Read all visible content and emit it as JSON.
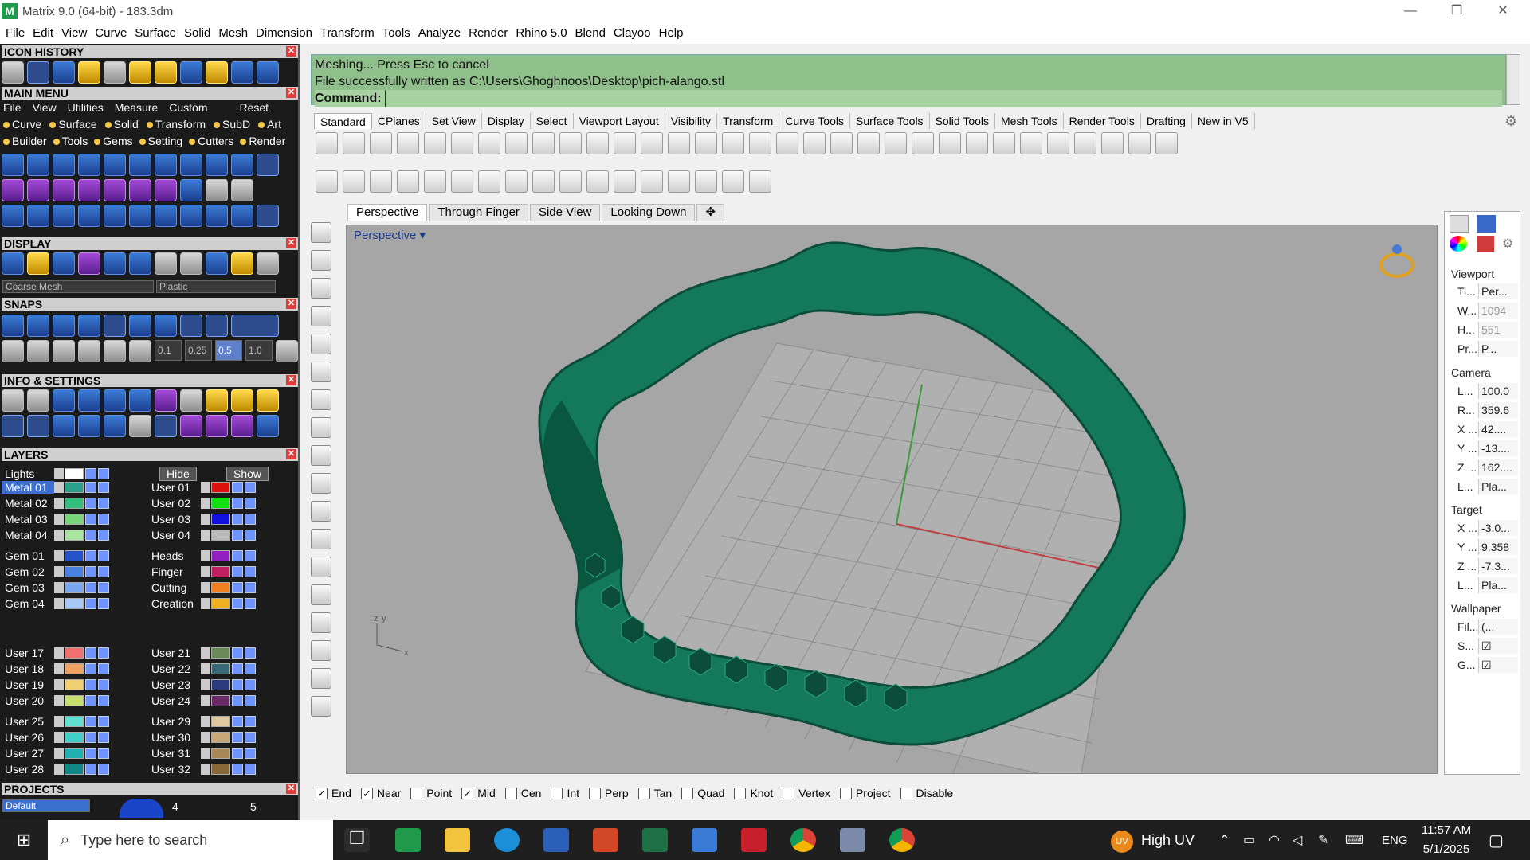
{
  "window": {
    "title": "Matrix 9.0 (64-bit) - 183.3dm",
    "minimize": "—",
    "restore": "❐",
    "close": "✕"
  },
  "menu": [
    "File",
    "Edit",
    "View",
    "Curve",
    "Surface",
    "Solid",
    "Mesh",
    "Dimension",
    "Transform",
    "Tools",
    "Analyze",
    "Render",
    "Rhino 5.0",
    "Blend",
    "Clayoo",
    "Help"
  ],
  "panels": {
    "icon_history": "ICON HISTORY",
    "main_menu": "MAIN MENU",
    "display": "DISPLAY",
    "snaps": "SNAPS",
    "info_settings": "INFO & SETTINGS",
    "layers": "LAYERS",
    "projects": "PROJECTS"
  },
  "main_menu_row1": [
    "File",
    "View",
    "Utilities",
    "Measure",
    "Custom",
    "Reset"
  ],
  "main_menu_row2": [
    "Curve",
    "Surface",
    "Solid",
    "Transform",
    "SubD",
    "Art"
  ],
  "main_menu_row3": [
    "Builder",
    "Tools",
    "Gems",
    "Setting",
    "Cutters",
    "Render"
  ],
  "display_selects": {
    "mesh": "Coarse Mesh",
    "material": "Plastic"
  },
  "snaps_values": [
    "0.1",
    "0.25",
    "0.5",
    "1.0"
  ],
  "layers": {
    "lights": "Lights",
    "hide": "Hide",
    "show": "Show",
    "left": [
      {
        "name": "Metal 01",
        "color": "#2aa08a",
        "selected": true
      },
      {
        "name": "Metal 02",
        "color": "#2fbf7a"
      },
      {
        "name": "Metal 03",
        "color": "#7ad67a"
      },
      {
        "name": "Metal 04",
        "color": "#a8e6a0"
      },
      {
        "name": "Gem 01",
        "color": "#2452c8"
      },
      {
        "name": "Gem 02",
        "color": "#4a80e0"
      },
      {
        "name": "Gem 03",
        "color": "#7aa8f0"
      },
      {
        "name": "Gem 04",
        "color": "#a8c8f8"
      },
      {
        "name": "User 17",
        "color": "#f07070"
      },
      {
        "name": "User 18",
        "color": "#f0a060"
      },
      {
        "name": "User 19",
        "color": "#f0d070"
      },
      {
        "name": "User 20",
        "color": "#c8e070"
      },
      {
        "name": "User 25",
        "color": "#60e0d0"
      },
      {
        "name": "User 26",
        "color": "#40d0c8"
      },
      {
        "name": "User 27",
        "color": "#20b0b0"
      },
      {
        "name": "User 28",
        "color": "#108888"
      }
    ],
    "right": [
      {
        "name": "User 01",
        "color": "#e01010"
      },
      {
        "name": "User 02",
        "color": "#10e010"
      },
      {
        "name": "User 03",
        "color": "#1010e0"
      },
      {
        "name": "User 04",
        "color": "#bbbbbb"
      },
      {
        "name": "Heads",
        "color": "#9020c0"
      },
      {
        "name": "Finger",
        "color": "#c02060"
      },
      {
        "name": "Cutting",
        "color": "#f08020"
      },
      {
        "name": "Creation",
        "color": "#f0b020"
      },
      {
        "name": "User 21",
        "color": "#6a8a5a"
      },
      {
        "name": "User 22",
        "color": "#3a6a7a"
      },
      {
        "name": "User 23",
        "color": "#2a3a7a"
      },
      {
        "name": "User 24",
        "color": "#6a2a6a"
      },
      {
        "name": "User 29",
        "color": "#e0c8a0"
      },
      {
        "name": "User 30",
        "color": "#c8a878"
      },
      {
        "name": "User 31",
        "color": "#a88858"
      },
      {
        "name": "User 32",
        "color": "#886838"
      }
    ]
  },
  "projects": {
    "default": "Default",
    "n1": "4",
    "n2": "5"
  },
  "command": {
    "line1": "Meshing... Press Esc to cancel",
    "line2": "File successfully written as C:\\Users\\Ghoghnoos\\Desktop\\pich-alango.stl",
    "prompt": "Command:"
  },
  "toolbar_tabs": [
    "Standard",
    "CPlanes",
    "Set View",
    "Display",
    "Select",
    "Viewport Layout",
    "Visibility",
    "Transform",
    "Curve Tools",
    "Surface Tools",
    "Solid Tools",
    "Mesh Tools",
    "Render Tools",
    "Drafting",
    "New in V5"
  ],
  "viewport_tabs": [
    "Perspective",
    "Through Finger",
    "Side View",
    "Looking Down"
  ],
  "viewport_label": "Perspective",
  "axis_labels": {
    "z": "z",
    "y": "y",
    "x": "x"
  },
  "properties": {
    "viewport_header": "Viewport",
    "title_k": "Ti...",
    "title_v": "Per...",
    "width_k": "W...",
    "width_v": "1094",
    "height_k": "H...",
    "height_v": "551",
    "proj_k": "Pr...",
    "proj_v": "P...",
    "camera_header": "Camera",
    "lens_k": "L...",
    "lens_v": "100.0",
    "rot_k": "R...",
    "rot_v": "359.6",
    "cx_k": "X ...",
    "cx_v": "42....",
    "cy_k": "Y ...",
    "cy_v": "-13....",
    "cz_k": "Z ...",
    "cz_v": "162....",
    "cl_k": "L...",
    "cl_v": "Pla...",
    "target_header": "Target",
    "tx_k": "X ...",
    "tx_v": "-3.0...",
    "ty_k": "Y ...",
    "ty_v": "9.358",
    "tz_k": "Z ...",
    "tz_v": "-7.3...",
    "tl_k": "L...",
    "tl_v": "Pla...",
    "wallpaper_header": "Wallpaper",
    "file_k": "Fil...",
    "file_v": "(...",
    "s_k": "S...",
    "g_k": "G..."
  },
  "osnaps": [
    {
      "label": "End",
      "checked": true
    },
    {
      "label": "Near",
      "checked": true
    },
    {
      "label": "Point",
      "checked": false
    },
    {
      "label": "Mid",
      "checked": true
    },
    {
      "label": "Cen",
      "checked": false
    },
    {
      "label": "Int",
      "checked": false
    },
    {
      "label": "Perp",
      "checked": false
    },
    {
      "label": "Tan",
      "checked": false
    },
    {
      "label": "Quad",
      "checked": false
    },
    {
      "label": "Knot",
      "checked": false
    },
    {
      "label": "Vertex",
      "checked": false
    },
    {
      "label": "Project",
      "checked": false
    },
    {
      "label": "Disable",
      "checked": false
    }
  ],
  "taskbar": {
    "search_placeholder": "Type here to search",
    "uv_badge": "UV",
    "uv_text": "High UV",
    "lang": "ENG",
    "time": "11:57 AM",
    "date": "5/1/2025"
  }
}
